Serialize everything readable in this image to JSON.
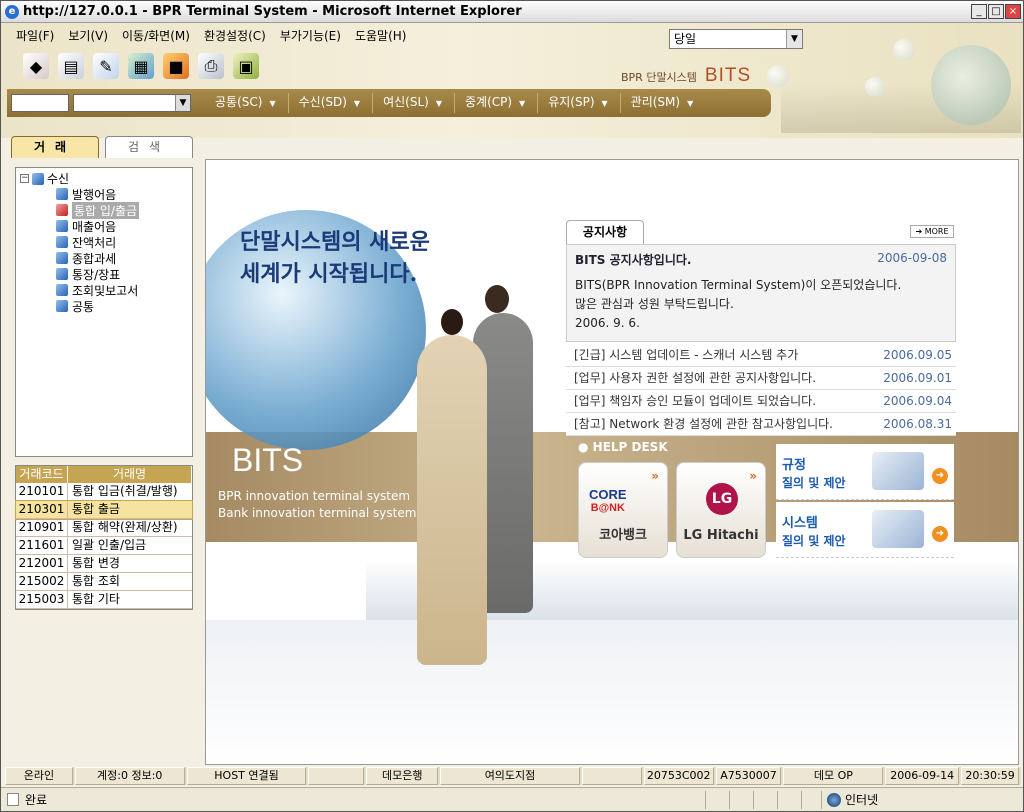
{
  "window": {
    "title": "http://127.0.0.1 - BPR Terminal System - Microsoft Internet Explorer",
    "buttons": [
      "_",
      "□",
      "×"
    ]
  },
  "menu": [
    "파일(F)",
    "보기(V)",
    "이동/화면(M)",
    "환경설정(C)",
    "부가기능(E)",
    "도움말(H)"
  ],
  "day_select": {
    "value": "당일"
  },
  "toolbar_icons": [
    "eraser-icon",
    "book-icon",
    "edit-icon",
    "network-icon",
    "blocks-icon",
    "printer-icon",
    "monitor-icon"
  ],
  "brand": {
    "sub": "BPR 단말시스템",
    "logo": "BITS"
  },
  "nav": {
    "items": [
      "공통(SC)",
      "수신(SD)",
      "여신(SL)",
      "중계(CP)",
      "유지(SP)",
      "관리(SM)"
    ]
  },
  "left_tabs": {
    "active": "거래",
    "inactive": "검색"
  },
  "tree": {
    "root": "수신",
    "children": [
      "발행어음",
      "통합 입/출금",
      "매출어음",
      "잔액처리",
      "종합과세",
      "통장/장표",
      "조회및보고서",
      "공통"
    ],
    "selected_index": 1
  },
  "grid": {
    "headers": [
      "거래코드",
      "거래명"
    ],
    "rows": [
      {
        "code": "210101",
        "name": "통합 입금(취결/발행)"
      },
      {
        "code": "210301",
        "name": "통합 출금"
      },
      {
        "code": "210901",
        "name": "통합 해약(완제/상환)"
      },
      {
        "code": "211601",
        "name": "일괄 인출/입금"
      },
      {
        "code": "212001",
        "name": "통합 변경"
      },
      {
        "code": "215002",
        "name": "통합 조회"
      },
      {
        "code": "215003",
        "name": "통합 기타"
      }
    ],
    "selected_index": 1
  },
  "banner": {
    "headline_1": "단말시스템의 새로운",
    "headline_2": "세계가 시작됩니다.",
    "bits": "BITS",
    "line_1": "BPR innovation terminal system",
    "line_2": "Bank innovation terminal system"
  },
  "notice": {
    "tab": "공지사항",
    "more": "➔ MORE",
    "featured": {
      "title": "BITS 공지사항입니다.",
      "date": "2006-09-08",
      "body_1": "BITS(BPR Innovation Terminal System)이 오픈되었습니다.",
      "body_2": "많은 관심과 성원 부탁드립니다.",
      "body_3": "2006. 9. 6."
    },
    "items": [
      {
        "text": "[긴급] 시스템 업데이트 - 스캐너 시스템 추가",
        "date": "2006.09.05"
      },
      {
        "text": "[업무] 사용자 권한 설정에 관한 공지사항입니다.",
        "date": "2006.09.01"
      },
      {
        "text": "[업무] 책임자 승인 모듈이 업데이트 되었습니다.",
        "date": "2006.09.04"
      },
      {
        "text": "[참고] Network 환경 설정에 관한 참고사항입니다.",
        "date": "2006.08.31"
      }
    ]
  },
  "helpdesk": {
    "title": "HELP DESK",
    "card1": {
      "logo_1": "CORE",
      "logo_2": "B@NK",
      "label": "코아뱅크"
    },
    "card2": {
      "logo": "LG",
      "label": "LG Hitachi"
    },
    "arrows": "»",
    "link1": {
      "t1": "규정",
      "t2": "질의 및 제안"
    },
    "link2": {
      "t1": "시스템",
      "t2": "질의 및 제안"
    }
  },
  "status": {
    "cells": [
      "온라인",
      "계정:0 정보:0",
      "HOST 연결됨",
      "",
      "데모은행",
      "여의도지점",
      "",
      "20753C002",
      "A7530007",
      "데모 OP",
      "2006-09-14",
      "20:30:59"
    ]
  },
  "iestatus": {
    "done": "완료",
    "zone": "인터넷"
  },
  "colors": {
    "accent": "#8d6f33",
    "grid_header": "#c6a552",
    "link": "#1a5ab0"
  }
}
